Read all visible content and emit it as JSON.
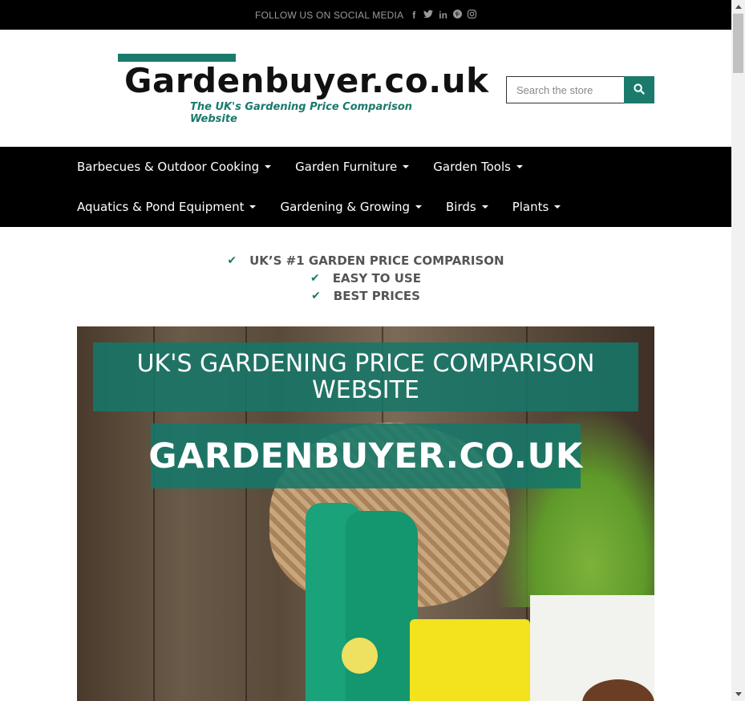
{
  "topbar": {
    "follow_text": "FOLLOW US ON SOCIAL MEDIA",
    "social_icons": [
      "facebook-icon",
      "twitter-icon",
      "linkedin-icon",
      "pinterest-icon",
      "instagram-icon"
    ],
    "facebook": "f",
    "twitter": "🐦",
    "linkedin": "in",
    "pinterest": "℗",
    "instagram": "◎"
  },
  "header": {
    "logo_name": "Gardenbuyer.co.uk",
    "logo_tagline": "The UK's Gardening Price Comparison Website",
    "search_placeholder": "Search the store"
  },
  "nav": {
    "row1": [
      "Barbecues & Outdoor Cooking",
      "Garden Furniture",
      "Garden Tools"
    ],
    "row2": [
      "Aquatics & Pond Equipment",
      "Gardening & Growing",
      "Birds",
      "Plants"
    ]
  },
  "usps": [
    "UK’S #1 GARDEN PRICE COMPARISON",
    "EASY TO USE",
    "BEST PRICES"
  ],
  "hero": {
    "banner_title": "UK'S GARDENING PRICE COMPARISON WEBSITE",
    "banner_brand": "GARDENBUYER.CO.UK"
  },
  "colors": {
    "accent": "#1a7a6c",
    "nav_bg": "#000000",
    "text_dark": "#111111"
  }
}
